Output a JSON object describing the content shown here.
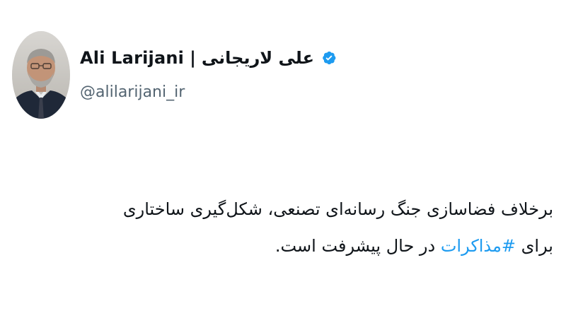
{
  "author": {
    "name_latin": "Ali Larijani",
    "separator": "|",
    "name_farsi": "علی لاریجانی",
    "handle": "@alilarijani_ir",
    "verified": true,
    "avatar": "profile-photo"
  },
  "tweet": {
    "line1": "برخلاف فضاسازی جنگ رسانه‌ای تصنعی، شکل‌گیری ساختاری",
    "line2_before": "برای ",
    "hashtag": "#مذاکرات",
    "line2_after": " در حال پیشرفت است."
  },
  "colors": {
    "text": "#0f1419",
    "secondary_text": "#536471",
    "link": "#1d9bf0",
    "verified_badge": "#1d9bf0"
  }
}
